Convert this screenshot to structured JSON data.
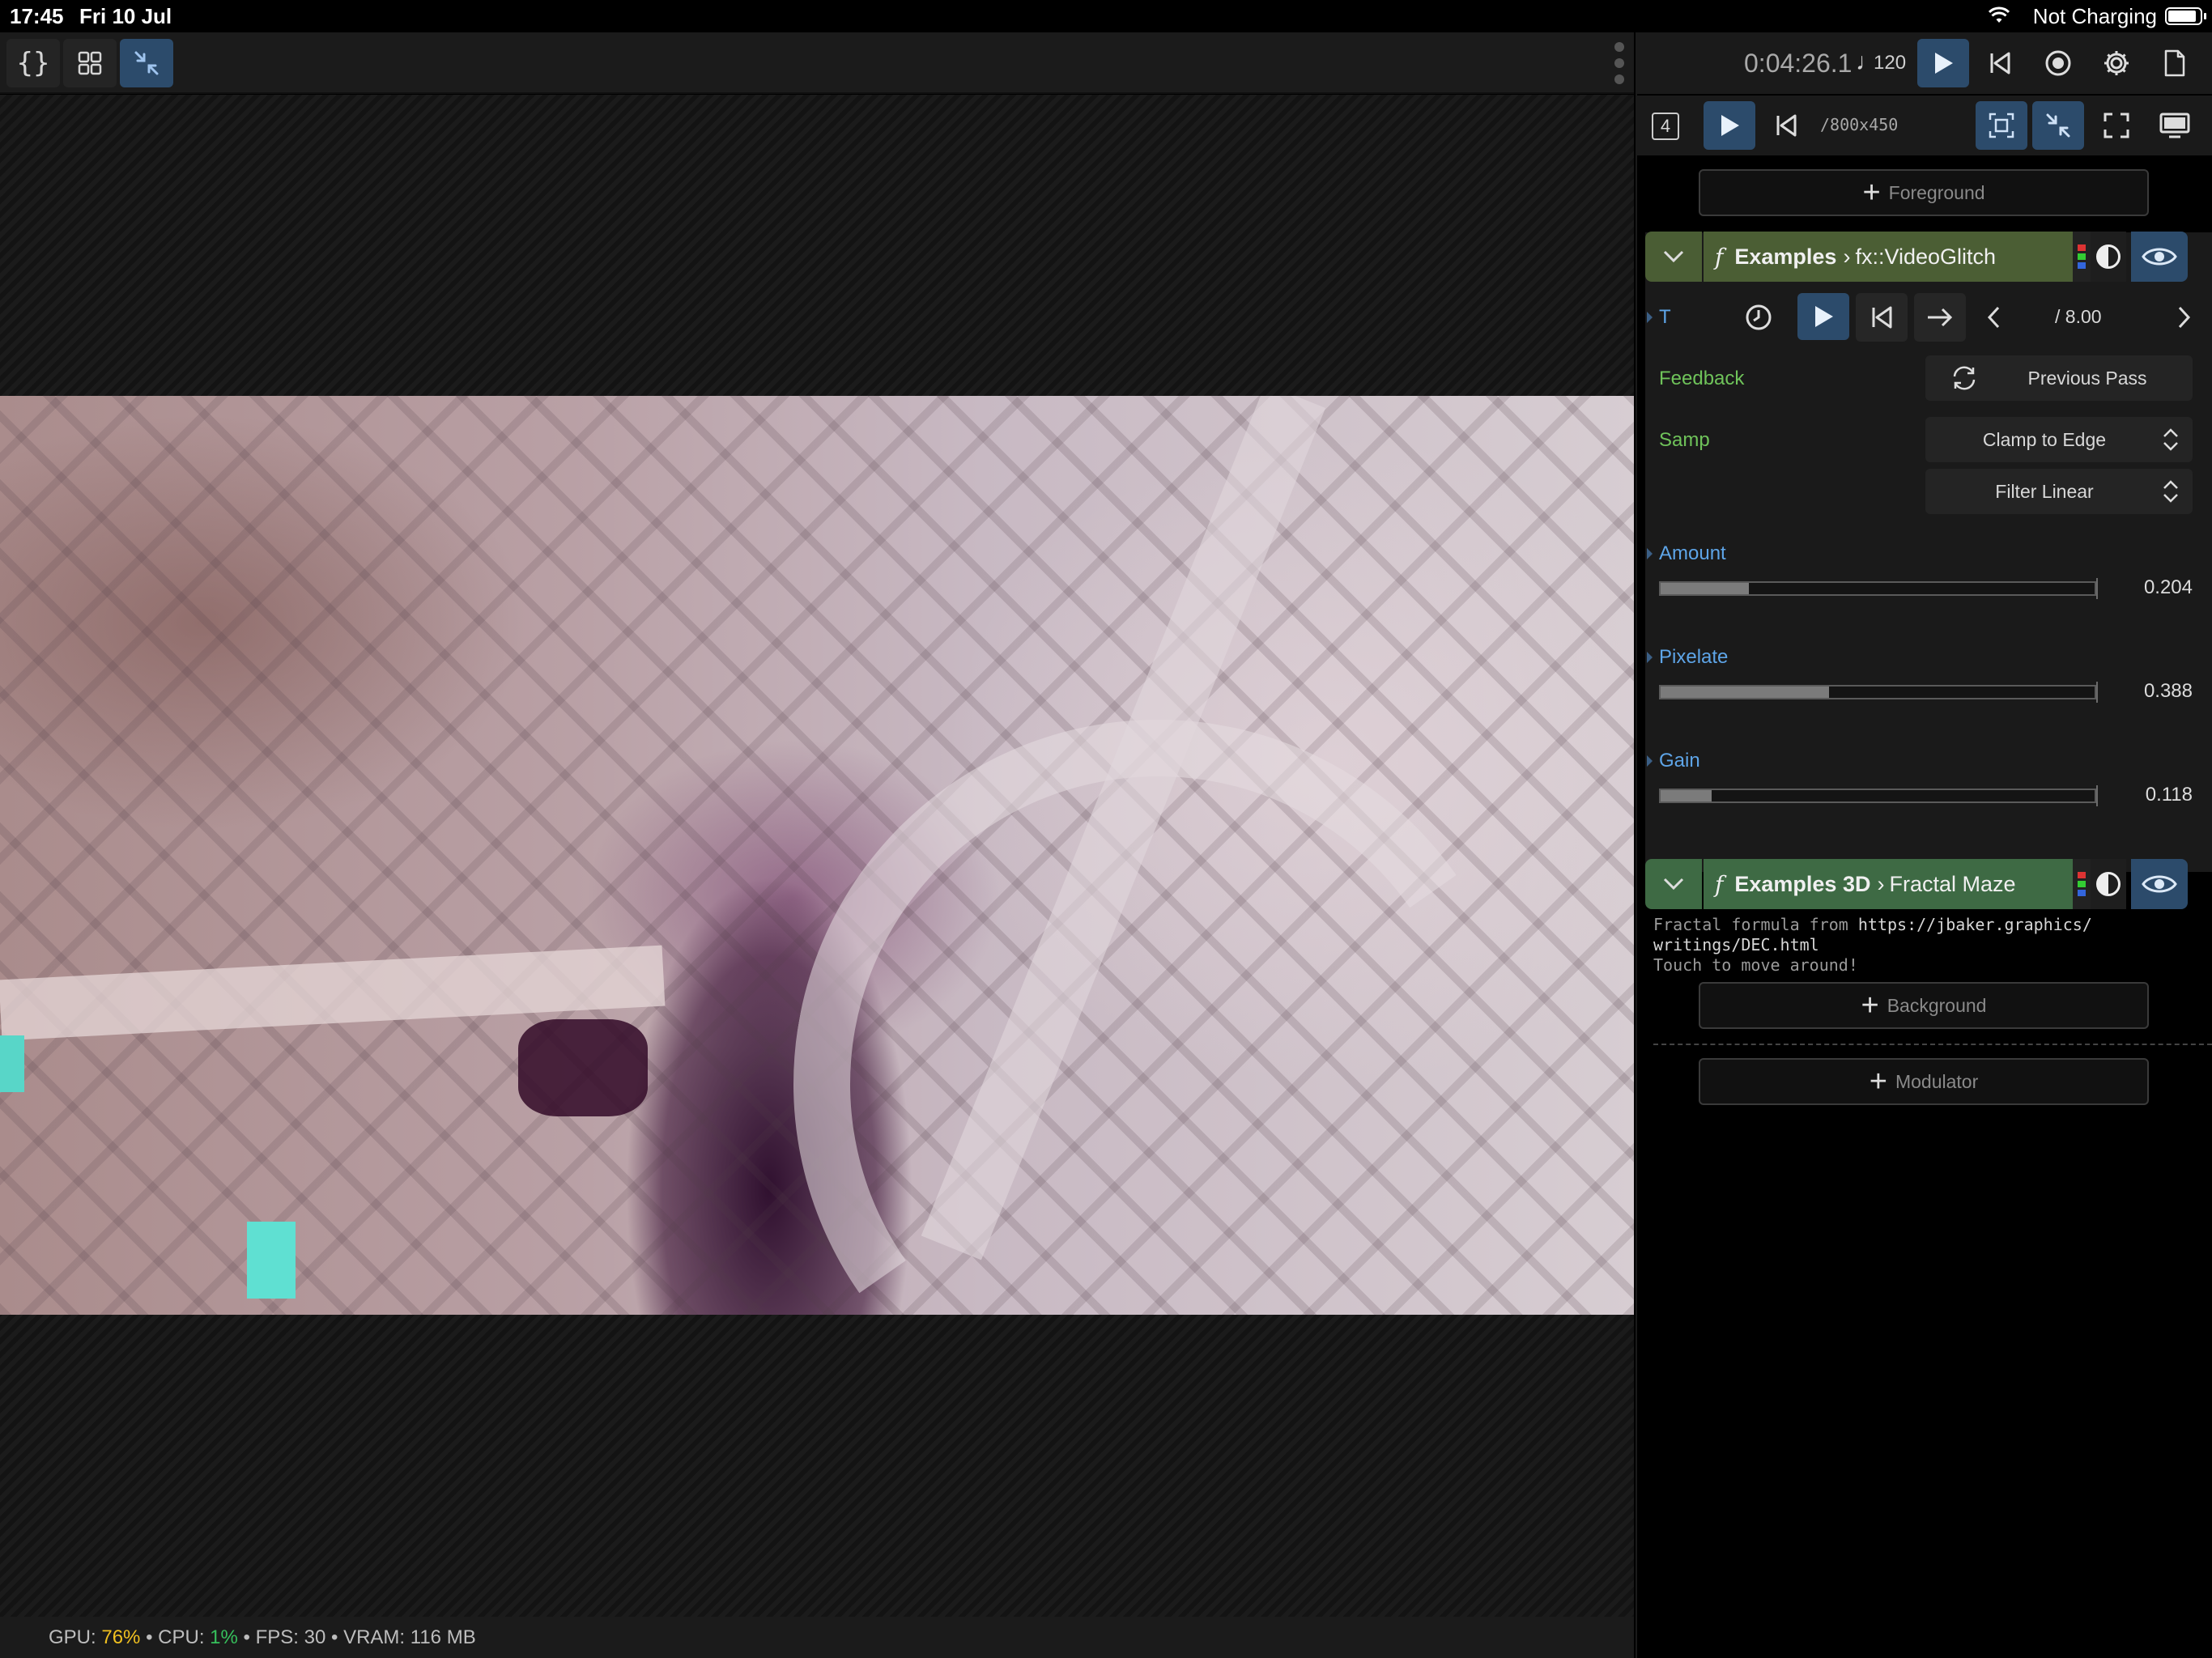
{
  "status_bar": {
    "time": "17:45",
    "date": "Fri 10 Jul",
    "charging_text": "Not Charging"
  },
  "left_toolbar": {
    "code_button": "{}",
    "grid_icon": "grid-icon",
    "collapse_icon": "collapse-arrows-icon"
  },
  "stats": {
    "gpu_label": "GPU:",
    "gpu_value": "76%",
    "cpu_label": "CPU:",
    "cpu_value": "1%",
    "fps_label": "FPS:",
    "fps_value": "30",
    "vram_label": "VRAM:",
    "vram_value": "116 MB",
    "sep": "•"
  },
  "transport": {
    "time": "0:04:26.1",
    "bpm_symbol": "♩",
    "bpm": "120"
  },
  "preview_bar": {
    "layer_count": "4",
    "resolution": "/800x450"
  },
  "foreground_button": "Foreground",
  "layer1": {
    "namespace": "Examples",
    "arrow": "›",
    "name": "fx::VideoGlitch",
    "time_param": "T",
    "time_value": "/ 8.00",
    "feedback_label": "Feedback",
    "feedback_value": "Previous Pass",
    "samp_label": "Samp",
    "samp_wrap": "Clamp to Edge",
    "samp_filter": "Filter Linear",
    "params": [
      {
        "label": "Amount",
        "value": "0.204",
        "fraction": 0.204
      },
      {
        "label": "Pixelate",
        "value": "0.388",
        "fraction": 0.388
      },
      {
        "label": "Gain",
        "value": "0.118",
        "fraction": 0.118
      }
    ]
  },
  "layer2": {
    "namespace": "Examples 3D",
    "arrow": "›",
    "name": "Fractal Maze",
    "desc_line1_prefix": "Fractal formula from ",
    "desc_line1_url": "https://jbaker.graphics/",
    "desc_line2": "writings/DEC.html",
    "desc_line3": "Touch to move around!"
  },
  "background_button": "Background",
  "modulator_button": "Modulator",
  "colors": {
    "accent_blue": "#2c4b6b",
    "layer_green": "#4b5e34",
    "gpu_yellow": "#f0c020",
    "cpu_green": "#36c05c"
  }
}
